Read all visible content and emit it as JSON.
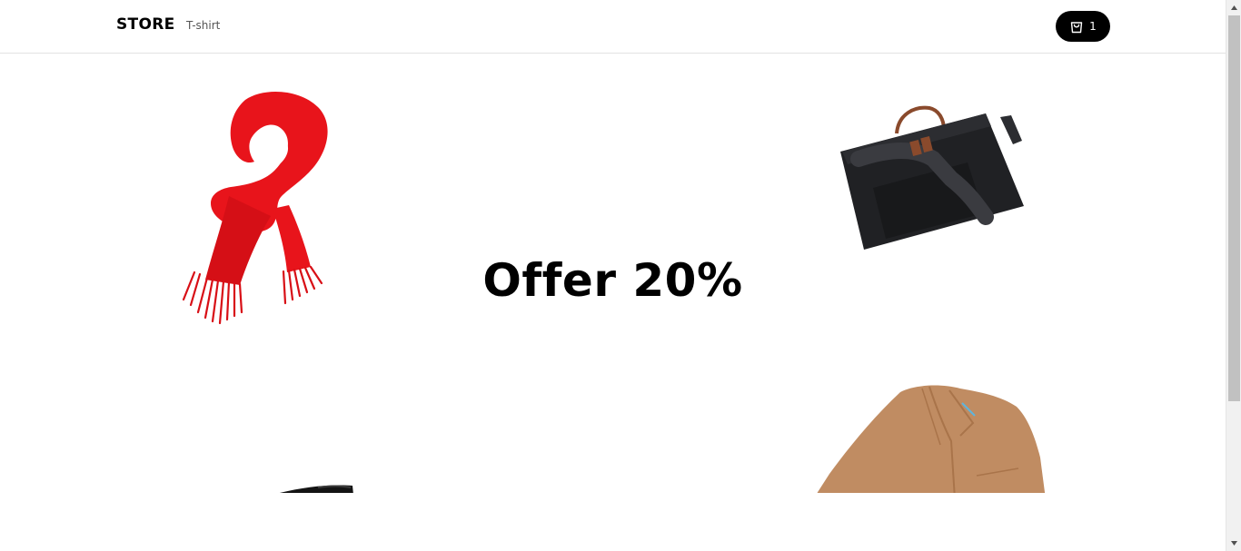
{
  "header": {
    "brand": "STORE",
    "nav": [
      {
        "label": "T-shirt"
      }
    ],
    "cart": {
      "icon": "shopping-bag-icon",
      "count": "1"
    }
  },
  "hero": {
    "title": "Offer 20%",
    "products": [
      {
        "name": "red scarf"
      },
      {
        "name": "black laptop bag"
      },
      {
        "name": "camel coat"
      },
      {
        "name": "black shoe"
      }
    ]
  },
  "colors": {
    "accent": "#000000",
    "scarf": "#e8141b",
    "bag": "#1e1f22",
    "coat": "#c08c62",
    "scrollbar_thumb": "#c1c1c1",
    "scrollbar_track": "#f1f1f1"
  }
}
